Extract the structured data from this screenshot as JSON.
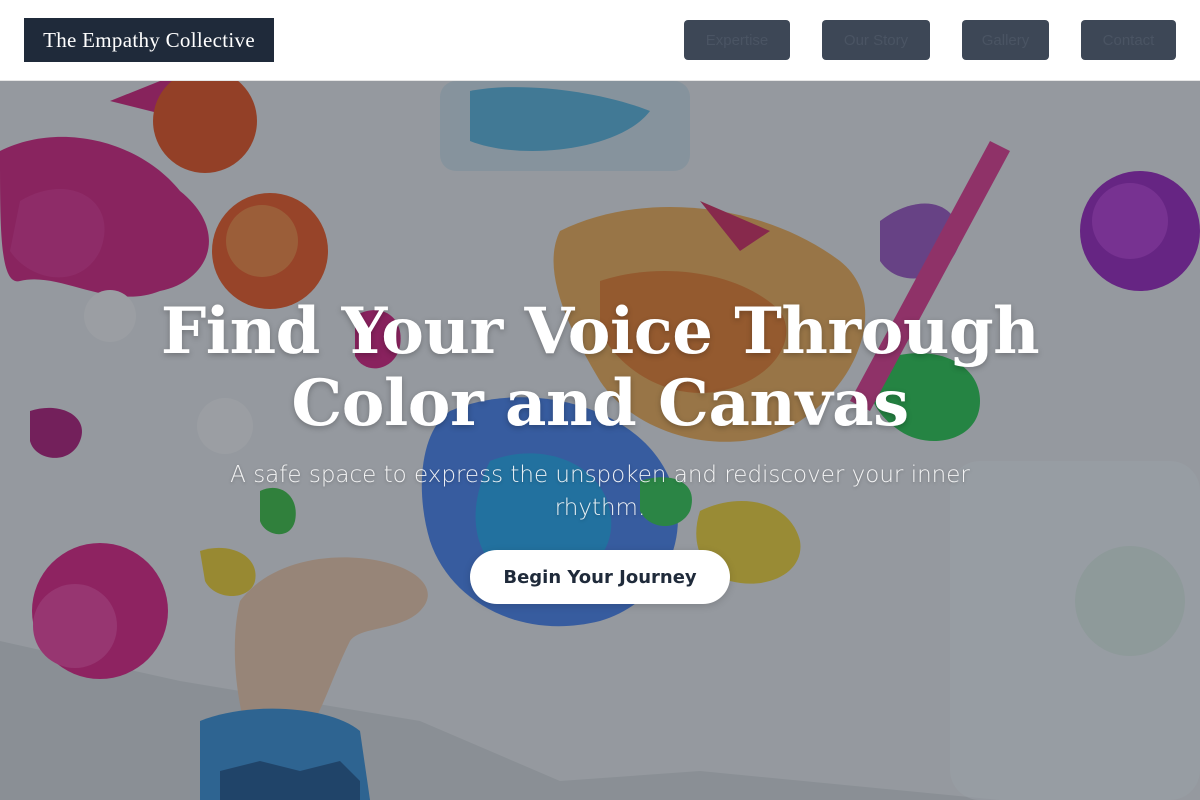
{
  "brand": {
    "name": "The Empathy Collective"
  },
  "nav": {
    "items": [
      {
        "label": "Expertise"
      },
      {
        "label": "Our Story"
      },
      {
        "label": "Gallery"
      },
      {
        "label": "Contact"
      }
    ]
  },
  "hero": {
    "headline": "Find Your Voice Through Color and Canvas",
    "subheadline": "A safe space to express the unspoken and rediscover your inner rhythm.",
    "cta_label": "Begin Your Journey"
  },
  "colors": {
    "brand_dark": "#1f2a3a",
    "nav_button": "#3d4756",
    "cta_background": "#ffffff",
    "overlay": "#1c283a"
  },
  "icons": {
    "hero_image": "paint-splatter-illustration"
  }
}
